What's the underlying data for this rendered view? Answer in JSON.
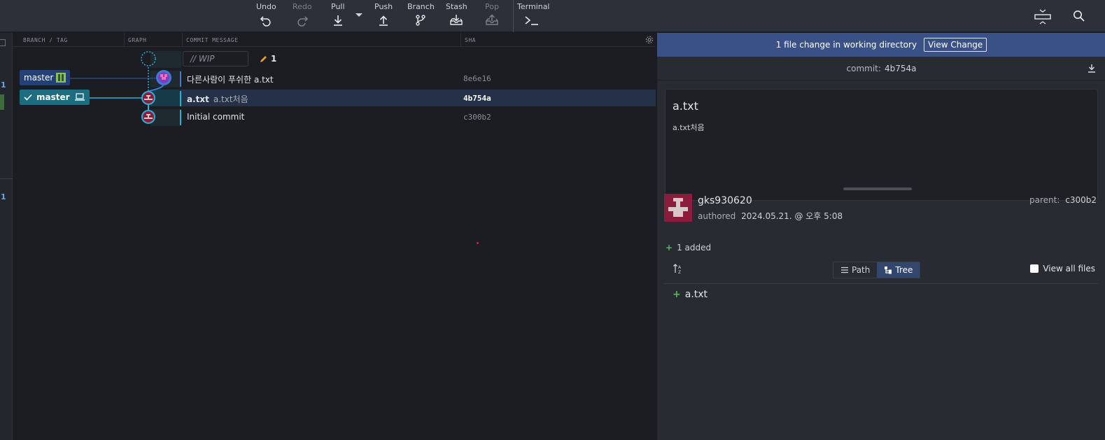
{
  "toolbar": {
    "undo": "Undo",
    "redo": "Redo",
    "pull": "Pull",
    "push": "Push",
    "branch": "Branch",
    "stash": "Stash",
    "pop": "Pop",
    "terminal": "Terminal"
  },
  "sliver": {
    "mark1": "1",
    "mark2": "1"
  },
  "columns": {
    "branch_tag": "BRANCH / TAG",
    "graph": "GRAPH",
    "commit_message": "COMMIT MESSAGE",
    "sha": "SHA"
  },
  "wip": {
    "placeholder": "// WIP",
    "count": "1"
  },
  "branches": {
    "remote": "master",
    "local": "master"
  },
  "commits": [
    {
      "message": "다른사람이 푸쉬한 a.txt",
      "sub": "",
      "sha": "8e6e16"
    },
    {
      "message": "a.txt",
      "sub": "a.txt처음",
      "sha": "4b754a"
    },
    {
      "message": "Initial commit",
      "sub": "",
      "sha": "c300b2"
    }
  ],
  "details": {
    "banner_text": "1 file change in working directory",
    "view_change": "View Change",
    "commit_label": "commit:",
    "commit_sha": "4b754a",
    "title": "a.txt",
    "body": "a.txt처음",
    "author": "gks930620",
    "authored_label": "authored",
    "authored_date": "2024.05.21. @ 오후 5:08",
    "parent_label": "parent:",
    "parent_sha": "c300b2",
    "added_text": "1 added",
    "path_label": "Path",
    "tree_label": "Tree",
    "view_all": "View all files",
    "file_name": "a.txt"
  },
  "colors": {
    "accent": "#3a5187",
    "selected_row": "#243148",
    "branch_blue": "#2a9fd6",
    "avatar_red": "#8c1c3b",
    "added_green": "#5cb85c"
  }
}
